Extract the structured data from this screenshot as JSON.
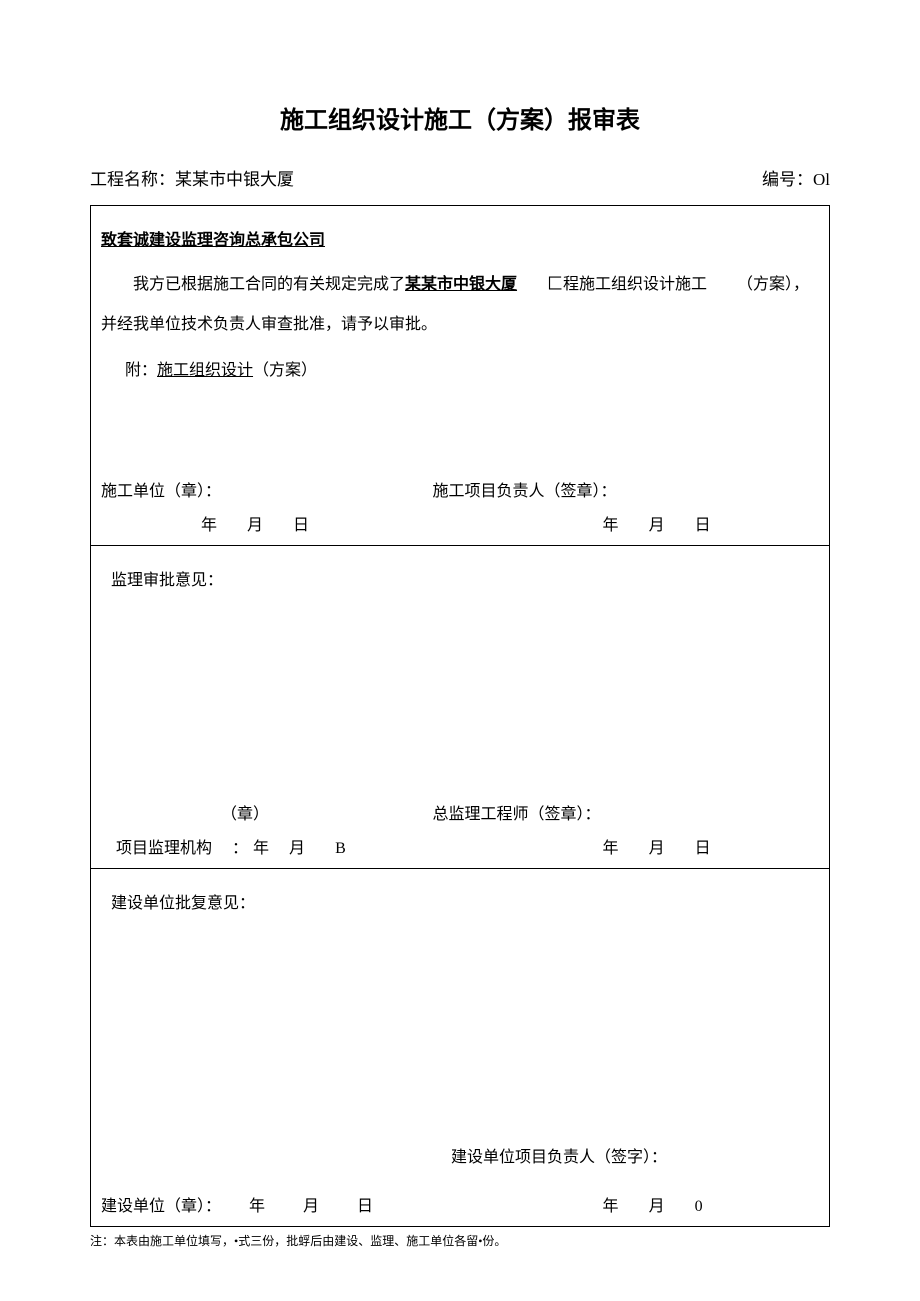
{
  "title": "施工组织设计施工（方案）报审表",
  "header": {
    "project_label": "工程名称：",
    "project_name": "某某市中银大厦",
    "number_label": "编号：",
    "number_value": "Ol"
  },
  "section1": {
    "addressee": "致套诚建设监理咨询总承包公司",
    "body_pre": "我方已根据施工合同的有关规定完成了",
    "body_bold": "某某市中银大厦",
    "body_post1": "匚程施工组织设计施工",
    "body_post2": "（方案），并经我单位技术负责人审查批准，请予以审批。",
    "attach_label": "附：",
    "attach_text": "施工组织设计",
    "attach_suffix": "（方案）",
    "left_sig": "施工单位（章）：",
    "right_sig": "施工项目负责人（签章）：",
    "year": "年",
    "month": "月",
    "day": "日"
  },
  "section2": {
    "opinion_label": "监理审批意见：",
    "stamp": "（章）",
    "right_sig": "总监理工程师（签章）：",
    "org_label": "项目监理机构",
    "colon": "：",
    "year": "年",
    "month": "月",
    "day_b": "B",
    "day": "日"
  },
  "section3": {
    "opinion_label": "建设单位批复意见：",
    "right_sig": "建设单位项目负责人（签字）：",
    "left_sig": "建设单位（章）：",
    "year": "年",
    "month": "月",
    "day": "日",
    "zero": "0"
  },
  "footnote": "注：本表由施工单位填写，•式三份，批蜉后由建设、监理、施工单位各留•份。"
}
